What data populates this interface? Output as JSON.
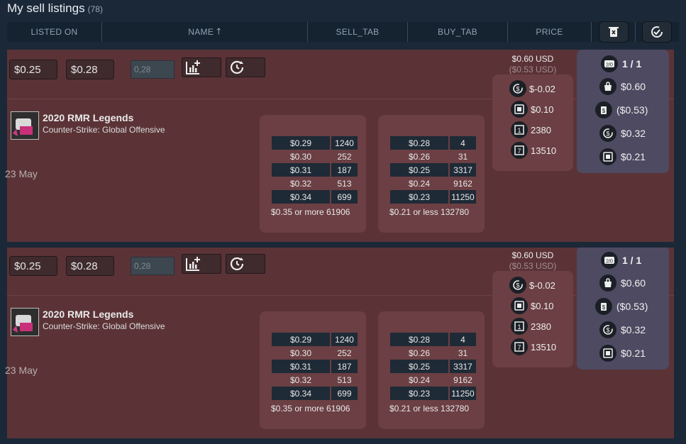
{
  "page": {
    "title": "My sell listings",
    "count": "(78)"
  },
  "header": {
    "listed_on": "LISTED ON",
    "name": "NAME",
    "sell_tab": "SELL_TAB",
    "buy_tab": "BUY_TAB",
    "price": "PRICE"
  },
  "listings": [
    {
      "price_a": "$0.25",
      "price_b": "$0.28",
      "input_placeholder": "0,28",
      "remove": "Remove",
      "item_name": "2020 RMR Legends",
      "game": "Counter-Strike: Global Offensive",
      "date": "23 May",
      "sell": [
        [
          "$0.29",
          "1240"
        ],
        [
          "$0.30",
          "252"
        ],
        [
          "$0.31",
          "187"
        ],
        [
          "$0.32",
          "513"
        ],
        [
          "$0.34",
          "699"
        ]
      ],
      "sell_more": "$0.35 or more 61906",
      "buy": [
        [
          "$0.28",
          "4"
        ],
        [
          "$0.26",
          "31"
        ],
        [
          "$0.25",
          "3317"
        ],
        [
          "$0.24",
          "9162"
        ],
        [
          "$0.23",
          "11250"
        ]
      ],
      "buy_less": "$0.21 or less 132780",
      "usd": "$0.60 USD",
      "usd_net": "($0.53 USD)",
      "stats": [
        "$-0.02",
        "$0.10",
        "2380",
        "13510"
      ],
      "side": [
        "1 / 1",
        "$0.60",
        "($0.53)",
        "$0.32",
        "$0.21"
      ]
    },
    {
      "price_a": "$0.25",
      "price_b": "$0.28",
      "input_placeholder": "0,28",
      "remove": "Remove",
      "item_name": "2020 RMR Legends",
      "game": "Counter-Strike: Global Offensive",
      "date": "23 May",
      "sell": [
        [
          "$0.29",
          "1240"
        ],
        [
          "$0.30",
          "252"
        ],
        [
          "$0.31",
          "187"
        ],
        [
          "$0.32",
          "513"
        ],
        [
          "$0.34",
          "699"
        ]
      ],
      "sell_more": "$0.35 or more 61906",
      "buy": [
        [
          "$0.28",
          "4"
        ],
        [
          "$0.26",
          "31"
        ],
        [
          "$0.25",
          "3317"
        ],
        [
          "$0.24",
          "9162"
        ],
        [
          "$0.23",
          "11250"
        ]
      ],
      "buy_less": "$0.21 or less 132780",
      "usd": "$0.60 USD",
      "usd_net": "($0.53 USD)",
      "stats": [
        "$-0.02",
        "$0.10",
        "2380",
        "13510"
      ],
      "side": [
        "1 / 1",
        "$0.60",
        "($0.53)",
        "$0.32",
        "$0.21"
      ]
    }
  ]
}
